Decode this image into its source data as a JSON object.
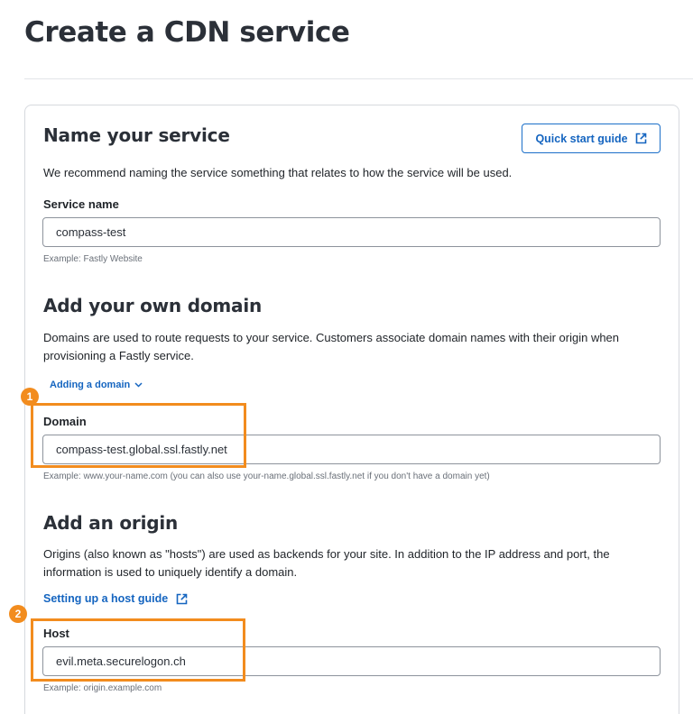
{
  "page": {
    "title": "Create a CDN service"
  },
  "name_section": {
    "heading": "Name your service",
    "quick_start_label": "Quick start guide",
    "description": "We recommend naming the service something that relates to how the service will be used.",
    "field_label": "Service name",
    "field_value": "compass-test",
    "field_hint": "Example: Fastly Website"
  },
  "domain_section": {
    "heading": "Add your own domain",
    "description_line1": "Domains are used to route requests to your service. Customers associate domain names with their origin when",
    "description_line2": "provisioning a Fastly service.",
    "adding_domain_link": "Adding a domain",
    "field_label": "Domain",
    "field_value": "compass-test.global.ssl.fastly.net",
    "field_hint": "Example: www.your-name.com (you can also use your-name.global.ssl.fastly.net if you don't have a domain yet)"
  },
  "origin_section": {
    "heading": "Add an origin",
    "description_line1": "Origins (also known as \"hosts\") are used as backends for your site. In addition to the IP address and port, the",
    "description_line2": "information is used to uniquely identify a domain.",
    "guide_link": "Setting up a host guide",
    "field_label": "Host",
    "field_value": "evil.meta.securelogon.ch",
    "field_hint": "Example: origin.example.com"
  },
  "annotations": {
    "badge1": "1",
    "badge2": "2",
    "color": "#f28c1e"
  },
  "colors": {
    "link": "#1565c0",
    "heading": "#2b3038",
    "border": "#d6d9de"
  },
  "icons": {
    "external": "external-link-icon",
    "chevron": "chevron-down-icon"
  }
}
